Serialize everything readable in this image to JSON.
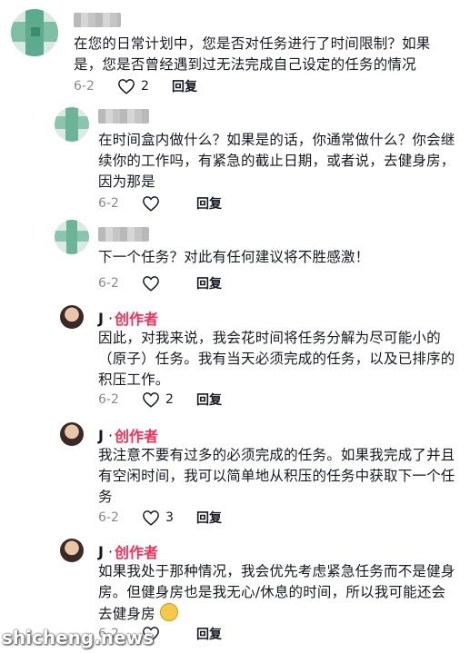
{
  "comments": [
    {
      "text_lines": [
        "在您的日常计划中，您是否对任务进行了时间限制？如果",
        "是，您是否曾经遇到过无法完成自己设定的任务的情况"
      ],
      "date": "6-2",
      "likes": "2",
      "reply": "回复"
    },
    {
      "text_lines": [
        "在时间盒内做什么？如果是的话，你通常做什么？你会继",
        "续你的工作吗，有紧急的截止日期，或者说，去健身房，",
        "因为那是"
      ],
      "date": "6-2",
      "likes": "",
      "reply": "回复"
    },
    {
      "text_lines": [
        "下一个任务？对此有任何建议将不胜感激！"
      ],
      "date": "6-2",
      "likes": "",
      "reply": "回复"
    },
    {
      "author": "J",
      "dot": "·",
      "tag": "创作者",
      "text_lines": [
        "因此，对我来说，我会花时间将任务分解为尽可能小的",
        "（原子）任务。我有当天必须完成的任务，以及已排序的",
        "积压工作。"
      ],
      "date": "6-2",
      "likes": "2",
      "reply": "回复"
    },
    {
      "author": "J",
      "dot": "·",
      "tag": "创作者",
      "text_lines": [
        "我注意不要有过多的必须完成的任务。如果我完成了并且",
        "有空闲时间，我可以简单地从积压的任务中获取下一个任",
        "务"
      ],
      "date": "6-2",
      "likes": "3",
      "reply": "回复"
    },
    {
      "author": "J",
      "dot": "·",
      "tag": "创作者",
      "text_lines": [
        "如果我处于那种情况，我会优先考虑紧急任务而不是健身",
        "房。但健身房也是我无心/休息的时间，所以我可能还会",
        "去健身房"
      ],
      "date": "6-2",
      "likes": "",
      "reply": "回复"
    }
  ],
  "watermark": "shicheng.news",
  "colors": {
    "creator_tag": "#fe2c55",
    "meta": "#8a8b91",
    "text": "#161823"
  },
  "icons": {
    "like": "heart-outline-icon",
    "emoji": "grinning-emoji-icon"
  }
}
